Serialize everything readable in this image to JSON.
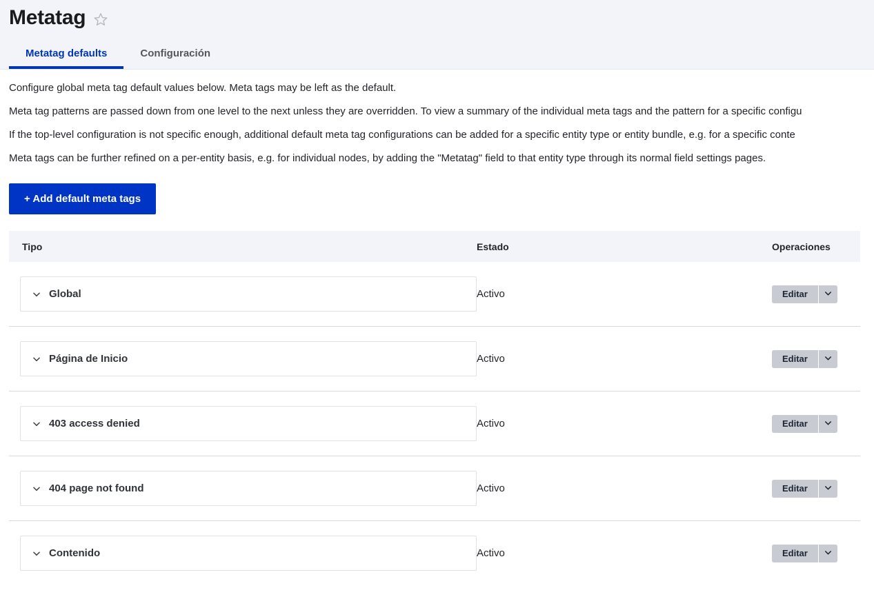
{
  "header": {
    "title": "Metatag",
    "star_icon": "star-outline-icon",
    "tabs": [
      {
        "label": "Metatag defaults",
        "active": true
      },
      {
        "label": "Configuración",
        "active": false
      }
    ]
  },
  "intro": {
    "lines": [
      "Configure global meta tag default values below. Meta tags may be left as the default.",
      "Meta tag patterns are passed down from one level to the next unless they are overridden. To view a summary of the individual meta tags and the pattern for a specific configu",
      "If the top-level configuration is not specific enough, additional default meta tag configurations can be added for a specific entity type or entity bundle, e.g. for a specific conte",
      "Meta tags can be further refined on a per-entity basis, e.g. for individual nodes, by adding the \"Metatag\" field to that entity type through its normal field settings pages."
    ]
  },
  "actions": {
    "add_button_label": "+ Add default meta tags"
  },
  "table": {
    "columns": [
      "Tipo",
      "Estado",
      "Operaciones"
    ],
    "rows": [
      {
        "tipo": "Global",
        "estado": "Activo",
        "edit_label": "Editar",
        "chevron_icon": "chevron-down-icon",
        "dropdown_icon": "chevron-down-icon"
      },
      {
        "tipo": "Página de Inicio",
        "estado": "Activo",
        "edit_label": "Editar",
        "chevron_icon": "chevron-down-icon",
        "dropdown_icon": "chevron-down-icon"
      },
      {
        "tipo": "403 access denied",
        "estado": "Activo",
        "edit_label": "Editar",
        "chevron_icon": "chevron-down-icon",
        "dropdown_icon": "chevron-down-icon"
      },
      {
        "tipo": "404 page not found",
        "estado": "Activo",
        "edit_label": "Editar",
        "chevron_icon": "chevron-down-icon",
        "dropdown_icon": "chevron-down-icon"
      },
      {
        "tipo": "Contenido",
        "estado": "Activo",
        "edit_label": "Editar",
        "chevron_icon": "chevron-down-icon",
        "dropdown_icon": "chevron-down-icon"
      }
    ]
  },
  "colors": {
    "header_band": "#f3f4f9",
    "accent_blue": "#0036b1",
    "button_blue": "#0034c4",
    "button_gray": "#c9cbd3",
    "text": "#232429",
    "border": "#d8d9de"
  }
}
